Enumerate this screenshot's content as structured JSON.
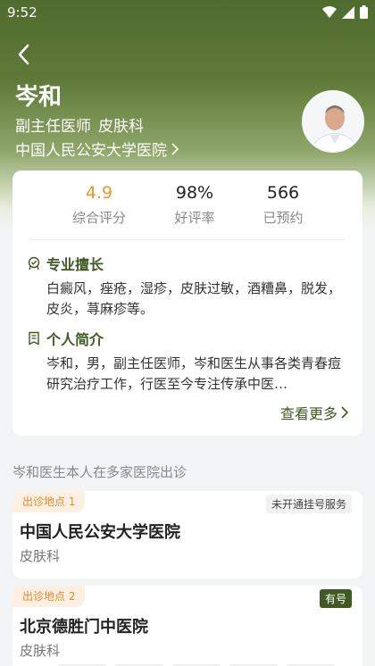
{
  "status_bar": {
    "time": "9:52"
  },
  "doctor": {
    "name": "岑和",
    "title": "副主任医师",
    "department": "皮肤科",
    "hospital": "中国人民公安大学医院"
  },
  "stats": [
    {
      "value": "4.9",
      "label": "综合评分",
      "color": "#f0952a"
    },
    {
      "value": "98%",
      "label": "好评率"
    },
    {
      "value": "566",
      "label": "已预约"
    }
  ],
  "specialty": {
    "heading": "专业擅长",
    "text": "白癜风，痤疮，湿疹，皮肤过敏，酒糟鼻，脱发，皮炎，荨麻疹等。"
  },
  "intro": {
    "heading": "个人简介",
    "text": "岑和，男，副主任医师，岑和医生从事各类青春痘研究治疗工作，行医至今专注传承中医…"
  },
  "more_label": "查看更多",
  "multi_site_note": "岑和医生本人在多家医院出诊",
  "locations": [
    {
      "tag": "出诊地点 1",
      "status": "未开通挂号服务",
      "name": "中国人民公安大学医院",
      "department": "皮肤科"
    },
    {
      "tag": "出诊地点 2",
      "status": "有号",
      "name": "北京德胜门中医院",
      "department": "皮肤科"
    }
  ],
  "colors": {
    "brand_green": "#3f5a22",
    "accent_orange": "#f0952a",
    "tag_orange": "#e0892e"
  },
  "icons": [
    "back-arrow-icon",
    "chevron-right-icon",
    "badge-icon",
    "document-icon",
    "wifi-icon",
    "signal-icon",
    "battery-icon"
  ]
}
